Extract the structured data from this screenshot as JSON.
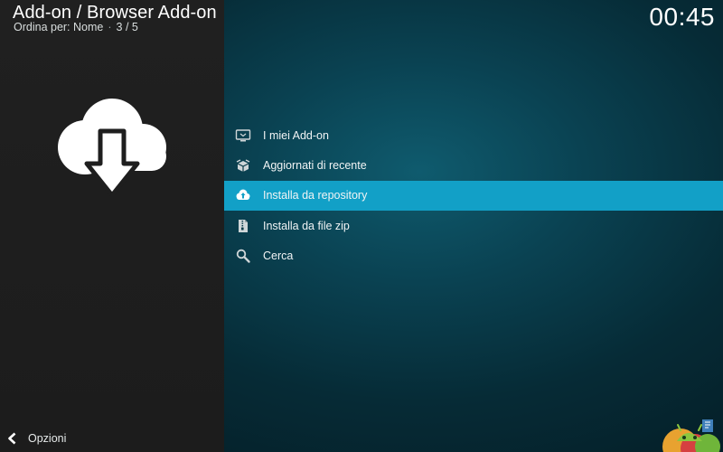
{
  "header": {
    "title": "Add-on / Browser Add-on",
    "sort_label": "Ordina per: Nome",
    "position": "3 / 5",
    "separator": "·"
  },
  "clock": "00:45",
  "big_icon": "cloud-download-icon",
  "menu": {
    "selected_index": 2,
    "items": [
      {
        "label": "I miei Add-on",
        "icon": "screen-icon"
      },
      {
        "label": "Aggiornati di recente",
        "icon": "open-box-icon"
      },
      {
        "label": "Installa da repository",
        "icon": "cloud-upload-icon"
      },
      {
        "label": "Installa da file zip",
        "icon": "zip-file-icon"
      },
      {
        "label": "Cerca",
        "icon": "search-icon"
      }
    ]
  },
  "footer": {
    "options_label": "Opzioni",
    "icon": "chevron-left-icon"
  },
  "colors": {
    "accent": "#12a0c7",
    "left_panel": "#1e1e1e",
    "background": "#0a4252"
  },
  "branding": {
    "logo": "android-logo"
  }
}
